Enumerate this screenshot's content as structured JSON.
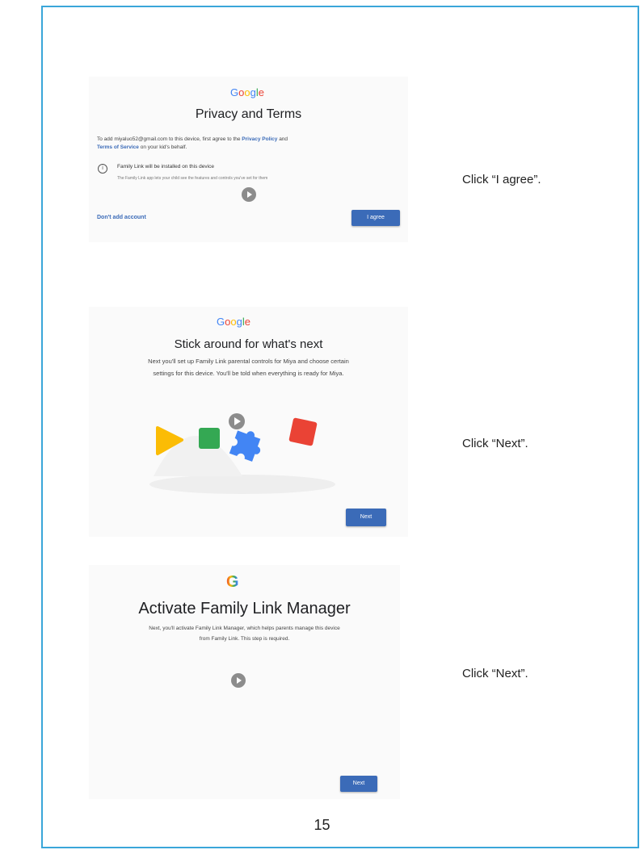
{
  "section1": {
    "logo": "Google",
    "title": "Privacy and Terms",
    "body_prefix": "To add miyaluo52@gmail.com to this device, first agree to the ",
    "privacy_policy": "Privacy Policy",
    "body_and": " and",
    "terms_of_service": "Terms of Service",
    "body_suffix": " on your kid's behalf.",
    "info_title": "Family Link will be installed on this device",
    "info_detail": "The Family Link app lets your child see the features and controls you've set for them",
    "dont_add": "Don't add account",
    "agree_button": "I agree",
    "caption": "Click “I agree”."
  },
  "section2": {
    "logo": "Google",
    "title": "Stick around for what's next",
    "body_line1": "Next you'll set up Family Link parental controls for Miya and choose certain",
    "body_line2": "settings for this device. You'll be told when everything is ready for Miya.",
    "next_button": "Next",
    "caption": "Click “Next”."
  },
  "section3": {
    "logo": "G",
    "title": "Activate Family Link Manager",
    "body_line1": "Next, you'll activate Family Link Manager, which helps parents manage this device",
    "body_line2": "from Family Link. This step is required.",
    "next_button": "Next",
    "caption": "Click “Next”."
  },
  "page_number": "15",
  "colors": {
    "frame": "#3aa6d9",
    "button": "#3b6bb8",
    "google_blue": "#4285f4",
    "google_red": "#ea4335",
    "google_yellow": "#fbbc05",
    "google_green": "#34a853"
  }
}
